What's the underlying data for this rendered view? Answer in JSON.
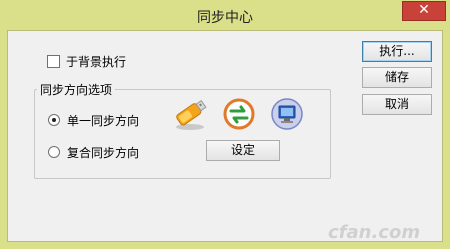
{
  "window": {
    "title": "同步中心",
    "close_glyph": "✕"
  },
  "options": {
    "background_run_label": "于背景执行",
    "background_run_checked": false
  },
  "group": {
    "legend": "同步方向选项",
    "radio_single": "单一同步方向",
    "radio_single_checked": true,
    "radio_multi": "复合同步方向",
    "radio_multi_checked": false,
    "settings_button": "设定",
    "icons": [
      "usb-drive-icon",
      "sync-arrows-icon",
      "computer-icon"
    ]
  },
  "buttons": {
    "execute": "执行...",
    "save": "储存",
    "cancel": "取消"
  },
  "colors": {
    "frame": "#d9e089",
    "close": "#c8423a",
    "client": "#f0f0f0"
  },
  "watermark": "cfan.com"
}
